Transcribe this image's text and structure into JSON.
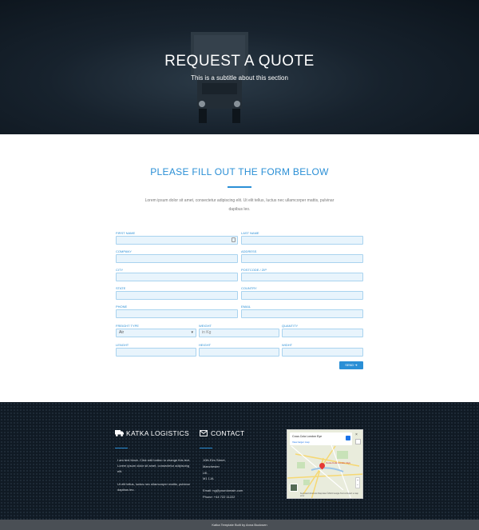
{
  "hero": {
    "title": "REQUEST A QUOTE",
    "subtitle": "This is a subtitle about this section"
  },
  "form_section": {
    "title": "PLEASE FILL OUT THE FORM BELOW",
    "intro": "Lorem ipsum dolor sit amet, consectetur adipiscing elit. Ut elit tellus, luctus nec ullamcorper mattis, pulvinar dapibus leo."
  },
  "form": {
    "first_name": {
      "label": "FIRST NAME",
      "value": ""
    },
    "last_name": {
      "label": "LAST NAME",
      "value": ""
    },
    "company": {
      "label": "COMPANY",
      "value": ""
    },
    "address": {
      "label": "ADDRESS",
      "value": ""
    },
    "city": {
      "label": "CITY",
      "value": ""
    },
    "postcode": {
      "label": "POSTCODE / ZIP",
      "value": ""
    },
    "state": {
      "label": "STATE",
      "value": ""
    },
    "country": {
      "label": "COUNTRY",
      "value": ""
    },
    "phone": {
      "label": "PHONE",
      "value": ""
    },
    "email": {
      "label": "EMAIL",
      "value": ""
    },
    "freight_type": {
      "label": "FREIGHT TYPE",
      "value": "Air"
    },
    "weight": {
      "label": "WEIGHT",
      "placeholder": "in Kg"
    },
    "quantity": {
      "label": "QUANTITY",
      "value": ""
    },
    "length": {
      "label": "LENGHT",
      "value": ""
    },
    "height": {
      "label": "HEIGHT",
      "value": ""
    },
    "width": {
      "label": "WIDHT",
      "value": ""
    },
    "send_label": "SEND ➔"
  },
  "footer": {
    "brand_heading": "KATKA LOGISTICS",
    "brand_icon": "truck-icon",
    "contact_heading": "CONTACT",
    "contact_icon": "envelope-icon",
    "about_text": "I am text block. Click edit button to change this text. Lorem ipsum dolor sit amet, consectetur adipiscing elit.",
    "about_text_2": "Ut elit tellus, luctus nec ullamcorper mattis, pulvinar dapibus leo.",
    "address_lines": [
      "10th Elm Street,",
      "Manchester",
      "UK,",
      "M1 1JA"
    ],
    "email": "Email: ng@yourdomain.com",
    "phone": "Phone: +44 722 11222",
    "map": {
      "place_name": "Coca-Cola London Eye",
      "link": "View larger map",
      "pin_label": "Coca-Cola London Eye",
      "zoom_in": "+",
      "zoom_out": "−",
      "close": "×",
      "credit": "Keyboard shortcuts  Map data ©2024 Google  Terms  Report a map error"
    }
  },
  "copyright": "Katka Template Built by Anna Buckwen",
  "colors": {
    "accent": "#2a8fd6",
    "footer_bg": "#101a24",
    "bottom_bar": "#4a4f55"
  }
}
